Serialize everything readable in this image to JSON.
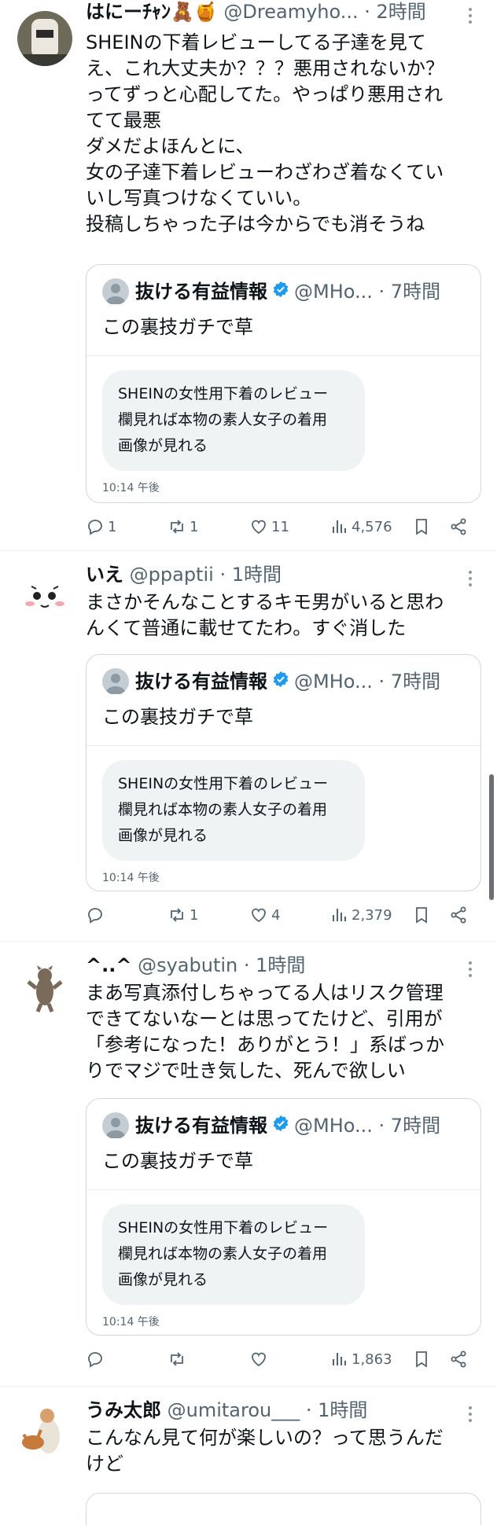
{
  "tweets": [
    {
      "name": "はにーﾁｬﾝ🧸🍯",
      "handle": "@Dreamyho...",
      "time": "· 2時間",
      "lines": [
        "SHEINの下着レビューしてる子達を見て",
        "え、これ大丈夫か？？？悪用されないか？",
        "ってずっと心配してた。やっぱり悪用され",
        "てて最悪",
        "ダメだよほんとに、",
        "女の子達下着レビューわざわざ着なくてい",
        "いし写真つけなくていい。",
        "投稿しちゃった子は今からでも消そうね"
      ],
      "quote": {
        "name": "抜ける有益情報",
        "handle": "@MHo...",
        "time": "· 7時間",
        "text": "この裏技ガチで草",
        "bubble": [
          "SHEINの女性用下着のレビュー",
          "欄見れば本物の素人女子の着用",
          "画像が見れる"
        ],
        "bubble_time": "10:14 午後"
      },
      "replies": "1",
      "retweets": "1",
      "likes": "11",
      "views": "4,576"
    },
    {
      "name": "いえ",
      "handle": "@ppaptii",
      "time": "· 1時間",
      "lines": [
        "まさかそんなことするキモ男がいると思わ",
        "んくて普通に載せてたわ。すぐ消した"
      ],
      "quote": {
        "name": "抜ける有益情報",
        "handle": "@MHo...",
        "time": "· 7時間",
        "text": "この裏技ガチで草",
        "bubble": [
          "SHEINの女性用下着のレビュー",
          "欄見れば本物の素人女子の着用",
          "画像が見れる"
        ],
        "bubble_time": "10:14 午後"
      },
      "replies": "",
      "retweets": "1",
      "likes": "4",
      "views": "2,379"
    },
    {
      "name": "^..^",
      "handle": "@syabutin",
      "time": "· 1時間",
      "lines": [
        "まあ写真添付しちゃってる人はリスク管理",
        "できてないなーとは思ってたけど、引用が",
        "「参考になった！ありがとう！」系ばっか",
        "りでマジで吐き気した、死んで欲しい"
      ],
      "quote": {
        "name": "抜ける有益情報",
        "handle": "@MHo...",
        "time": "· 7時間",
        "text": "この裏技ガチで草",
        "bubble": [
          "SHEINの女性用下着のレビュー",
          "欄見れば本物の素人女子の着用",
          "画像が見れる"
        ],
        "bubble_time": "10:14 午後"
      },
      "replies": "",
      "retweets": "",
      "likes": "",
      "views": "1,863"
    },
    {
      "name": "うみ太郎",
      "handle": "@umitarou___",
      "time": "· 1時間",
      "lines": [
        "こんなん見て何が楽しいの？って思うんだ",
        "けど"
      ]
    }
  ],
  "colors": {
    "text": "#0f1419",
    "secondary": "#536471",
    "border": "#cfd9de",
    "verified": "#1d9bf0",
    "bubble": "#eff3f4"
  }
}
